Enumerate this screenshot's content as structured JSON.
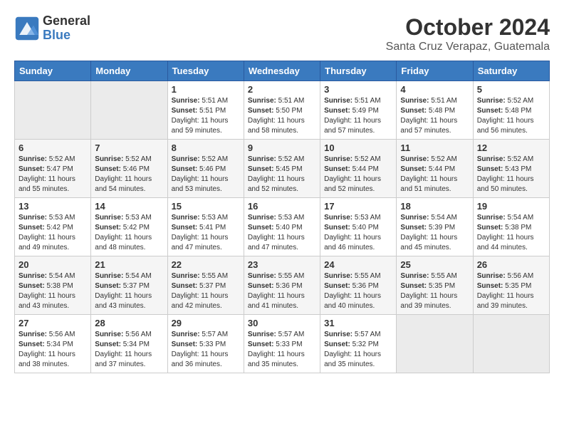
{
  "header": {
    "logo_line1": "General",
    "logo_line2": "Blue",
    "title": "October 2024",
    "subtitle": "Santa Cruz Verapaz, Guatemala"
  },
  "weekdays": [
    "Sunday",
    "Monday",
    "Tuesday",
    "Wednesday",
    "Thursday",
    "Friday",
    "Saturday"
  ],
  "weeks": [
    [
      {
        "day": "",
        "empty": true
      },
      {
        "day": "",
        "empty": true
      },
      {
        "day": "1",
        "sunrise": "5:51 AM",
        "sunset": "5:51 PM",
        "daylight": "11 hours and 59 minutes."
      },
      {
        "day": "2",
        "sunrise": "5:51 AM",
        "sunset": "5:50 PM",
        "daylight": "11 hours and 58 minutes."
      },
      {
        "day": "3",
        "sunrise": "5:51 AM",
        "sunset": "5:49 PM",
        "daylight": "11 hours and 57 minutes."
      },
      {
        "day": "4",
        "sunrise": "5:51 AM",
        "sunset": "5:48 PM",
        "daylight": "11 hours and 57 minutes."
      },
      {
        "day": "5",
        "sunrise": "5:52 AM",
        "sunset": "5:48 PM",
        "daylight": "11 hours and 56 minutes."
      }
    ],
    [
      {
        "day": "6",
        "sunrise": "5:52 AM",
        "sunset": "5:47 PM",
        "daylight": "11 hours and 55 minutes."
      },
      {
        "day": "7",
        "sunrise": "5:52 AM",
        "sunset": "5:46 PM",
        "daylight": "11 hours and 54 minutes."
      },
      {
        "day": "8",
        "sunrise": "5:52 AM",
        "sunset": "5:46 PM",
        "daylight": "11 hours and 53 minutes."
      },
      {
        "day": "9",
        "sunrise": "5:52 AM",
        "sunset": "5:45 PM",
        "daylight": "11 hours and 52 minutes."
      },
      {
        "day": "10",
        "sunrise": "5:52 AM",
        "sunset": "5:44 PM",
        "daylight": "11 hours and 52 minutes."
      },
      {
        "day": "11",
        "sunrise": "5:52 AM",
        "sunset": "5:44 PM",
        "daylight": "11 hours and 51 minutes."
      },
      {
        "day": "12",
        "sunrise": "5:52 AM",
        "sunset": "5:43 PM",
        "daylight": "11 hours and 50 minutes."
      }
    ],
    [
      {
        "day": "13",
        "sunrise": "5:53 AM",
        "sunset": "5:42 PM",
        "daylight": "11 hours and 49 minutes."
      },
      {
        "day": "14",
        "sunrise": "5:53 AM",
        "sunset": "5:42 PM",
        "daylight": "11 hours and 48 minutes."
      },
      {
        "day": "15",
        "sunrise": "5:53 AM",
        "sunset": "5:41 PM",
        "daylight": "11 hours and 47 minutes."
      },
      {
        "day": "16",
        "sunrise": "5:53 AM",
        "sunset": "5:40 PM",
        "daylight": "11 hours and 47 minutes."
      },
      {
        "day": "17",
        "sunrise": "5:53 AM",
        "sunset": "5:40 PM",
        "daylight": "11 hours and 46 minutes."
      },
      {
        "day": "18",
        "sunrise": "5:54 AM",
        "sunset": "5:39 PM",
        "daylight": "11 hours and 45 minutes."
      },
      {
        "day": "19",
        "sunrise": "5:54 AM",
        "sunset": "5:38 PM",
        "daylight": "11 hours and 44 minutes."
      }
    ],
    [
      {
        "day": "20",
        "sunrise": "5:54 AM",
        "sunset": "5:38 PM",
        "daylight": "11 hours and 43 minutes."
      },
      {
        "day": "21",
        "sunrise": "5:54 AM",
        "sunset": "5:37 PM",
        "daylight": "11 hours and 43 minutes."
      },
      {
        "day": "22",
        "sunrise": "5:55 AM",
        "sunset": "5:37 PM",
        "daylight": "11 hours and 42 minutes."
      },
      {
        "day": "23",
        "sunrise": "5:55 AM",
        "sunset": "5:36 PM",
        "daylight": "11 hours and 41 minutes."
      },
      {
        "day": "24",
        "sunrise": "5:55 AM",
        "sunset": "5:36 PM",
        "daylight": "11 hours and 40 minutes."
      },
      {
        "day": "25",
        "sunrise": "5:55 AM",
        "sunset": "5:35 PM",
        "daylight": "11 hours and 39 minutes."
      },
      {
        "day": "26",
        "sunrise": "5:56 AM",
        "sunset": "5:35 PM",
        "daylight": "11 hours and 39 minutes."
      }
    ],
    [
      {
        "day": "27",
        "sunrise": "5:56 AM",
        "sunset": "5:34 PM",
        "daylight": "11 hours and 38 minutes."
      },
      {
        "day": "28",
        "sunrise": "5:56 AM",
        "sunset": "5:34 PM",
        "daylight": "11 hours and 37 minutes."
      },
      {
        "day": "29",
        "sunrise": "5:57 AM",
        "sunset": "5:33 PM",
        "daylight": "11 hours and 36 minutes."
      },
      {
        "day": "30",
        "sunrise": "5:57 AM",
        "sunset": "5:33 PM",
        "daylight": "11 hours and 35 minutes."
      },
      {
        "day": "31",
        "sunrise": "5:57 AM",
        "sunset": "5:32 PM",
        "daylight": "11 hours and 35 minutes."
      },
      {
        "day": "",
        "empty": true
      },
      {
        "day": "",
        "empty": true
      }
    ]
  ],
  "labels": {
    "sunrise": "Sunrise: ",
    "sunset": "Sunset: ",
    "daylight": "Daylight: "
  }
}
